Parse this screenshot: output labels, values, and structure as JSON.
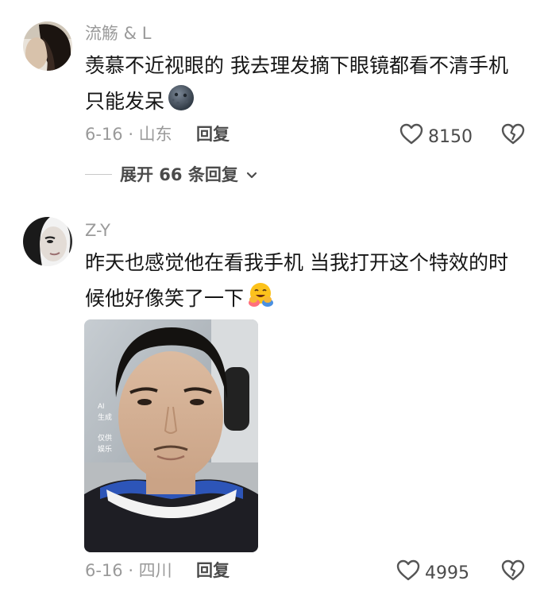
{
  "comments": [
    {
      "username": "流觞 & L",
      "text_line1": "羡慕不近视眼的 我去理发摘下眼镜都看不清手机",
      "text_line2": "只能发呆",
      "date_location": "6-16 · 山东",
      "reply_label": "回复",
      "likes": "8150",
      "emoji_icon": "new-moon-face-icon"
    },
    {
      "username": "Z-Y",
      "text_line1": "昨天也感觉他在看我手机 当我打开这个特效的时",
      "text_line2": "候他好像笑了一下",
      "date_location": "6-16 · 四川",
      "reply_label": "回复",
      "likes": "4995",
      "emoji_icon": "hugging-face-icon",
      "photo_watermark": [
        "AI",
        "生成",
        "仅供",
        "娱乐"
      ]
    }
  ],
  "expand_replies": "展开 66 条回复",
  "colors": {
    "meta": "#9a9a9a",
    "text": "#161616",
    "action": "#4b4b4b"
  }
}
